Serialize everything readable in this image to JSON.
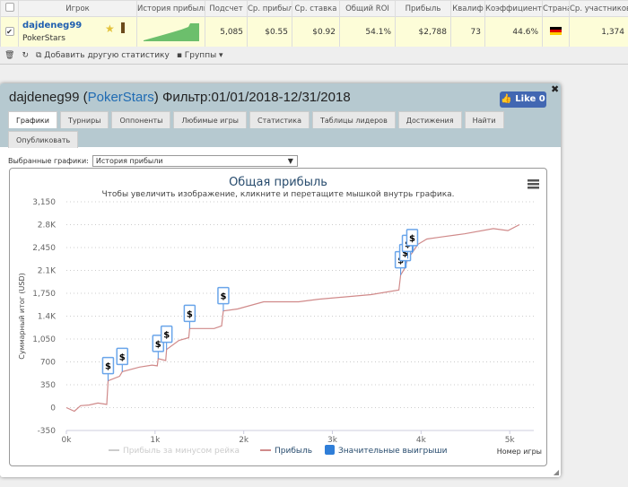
{
  "table": {
    "headers": [
      "Игрок",
      "История прибыли",
      "Подсчет",
      "Ср. прибыль",
      "Ср. ставка",
      "Общий ROI",
      "Прибыль",
      "Квалиф",
      "Коэффициент",
      "Страна",
      "Ср. участников"
    ],
    "row": {
      "player": "dajdeneg99",
      "network": "PokerStars",
      "count": "5,085",
      "avg_profit": "$0.55",
      "avg_stake": "$0.92",
      "roi": "54.1%",
      "profit": "$2,788",
      "qualif": "73",
      "coef": "44.6%",
      "country_flag": "germany-flag",
      "avg_entrants": "1,374",
      "checked": true
    }
  },
  "toolbar": {
    "add_stat": "Добавить другую статистику",
    "groups": "Группы"
  },
  "dialog": {
    "player": "dajdeneg99",
    "network": "PokerStars",
    "filter": "Фильтр:01/01/2018-12/31/2018",
    "like": "Like 0",
    "tabs": [
      "Графики",
      "Турниры",
      "Оппоненты",
      "Любимые игры",
      "Статистика",
      "Таблицы лидеров",
      "Достижения",
      "Найти",
      "Опубликовать"
    ],
    "active_tab": "Графики",
    "selected_label": "Выбранные графики:",
    "selected_value": "История прибыли"
  },
  "chart_data": {
    "type": "line",
    "title": "Общая прибыль",
    "subtitle": "Чтобы увеличить изображение, кликните и перетащите мышкой внутрь графика.",
    "xlabel": "Номер игры",
    "ylabel": "Суммарный итог (USD)",
    "xlim": [
      0,
      5150
    ],
    "ylim": [
      -350,
      3150
    ],
    "x_ticks": [
      0,
      1000,
      2000,
      3000,
      4000,
      5000
    ],
    "x_tick_labels": [
      "0k",
      "1k",
      "2k",
      "3k",
      "4k",
      "5k"
    ],
    "y_ticks": [
      -350,
      0,
      350,
      700,
      1050,
      1400,
      1750,
      2100,
      2450,
      2800,
      3150
    ],
    "y_tick_labels": [
      "-350",
      "0",
      "350",
      "700",
      "1,050",
      "1.4K",
      "1,750",
      "2.1K",
      "2,450",
      "2.8K",
      "3,150"
    ],
    "grid": true,
    "legend_position": "bottom",
    "series": [
      {
        "name": "Прибыль за минусом рейка",
        "color": "#cccccc",
        "visible": false,
        "x": [],
        "y": []
      },
      {
        "name": "Прибыль",
        "color": "#d08a8a",
        "x": [
          0,
          90,
          160,
          255,
          355,
          455,
          470,
          600,
          630,
          825,
          965,
          1025,
          1035,
          1120,
          1130,
          1270,
          1380,
          1390,
          1665,
          1750,
          1770,
          1930,
          2225,
          2620,
          2845,
          3435,
          3750,
          3770,
          3820,
          3850,
          3900,
          3965,
          4065,
          4220,
          4490,
          4815,
          4980,
          5110
        ],
        "y": [
          0,
          -55,
          30,
          40,
          70,
          50,
          410,
          480,
          550,
          620,
          650,
          640,
          750,
          720,
          890,
          1030,
          1070,
          1210,
          1210,
          1250,
          1480,
          1510,
          1620,
          1620,
          1660,
          1730,
          1800,
          2030,
          2140,
          2280,
          2370,
          2500,
          2580,
          2610,
          2660,
          2740,
          2710,
          2800
        ]
      },
      {
        "name": "Значительные выигрыши",
        "color": "#2f7ed8",
        "marker": "$",
        "x": [
          470,
          630,
          1035,
          1130,
          1390,
          1770,
          3770,
          3820,
          3850,
          3900
        ]
      }
    ]
  }
}
